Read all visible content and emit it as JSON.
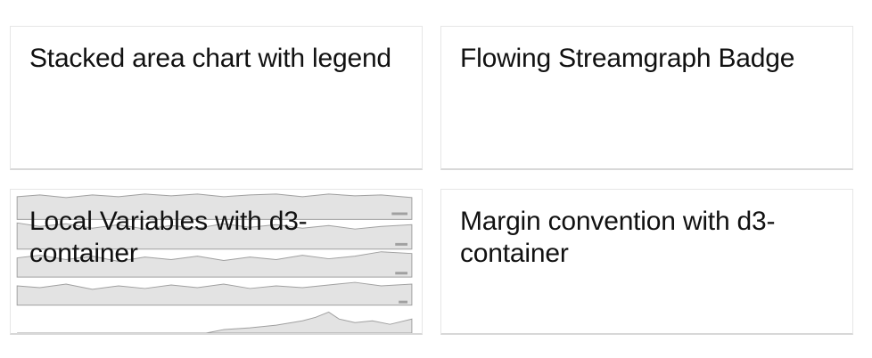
{
  "cards": [
    {
      "title": "Stacked area chart with legend",
      "has_thumbnail": false
    },
    {
      "title": "Flowing Streamgraph Badge",
      "has_thumbnail": false
    },
    {
      "title": "Local Variables with d3-container",
      "has_thumbnail": true
    },
    {
      "title": "Margin convention with d3-container",
      "has_thumbnail": false
    }
  ],
  "colors": {
    "card_background": "#ffffff",
    "card_border": "#e6e6e6",
    "thumbnail_fill": "#e3e3e3",
    "thumbnail_line": "#a0a0a0",
    "title_text": "#111111"
  }
}
